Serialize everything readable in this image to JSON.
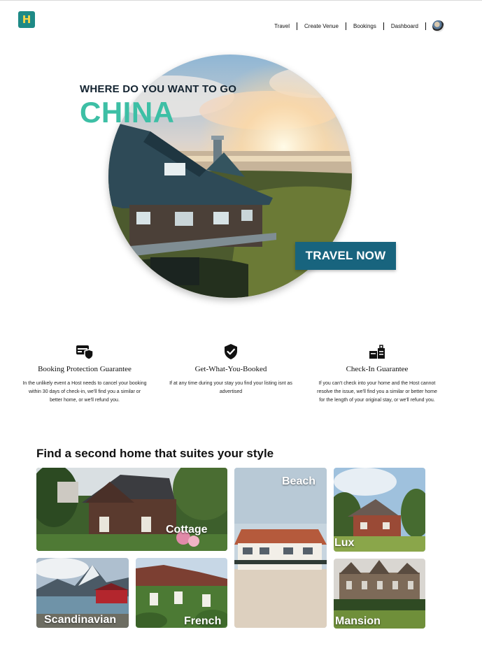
{
  "header": {
    "logo_letter": "H",
    "nav": [
      "Travel",
      "Create Venue",
      "Bookings",
      "Dashboard"
    ]
  },
  "hero": {
    "kicker": "WHERE DO YOU WANT TO GO",
    "destination": "CHINA",
    "cta": "TRAVEL NOW"
  },
  "features": [
    {
      "icon": "booking-protection-icon",
      "title": "Booking Protection Guarantee",
      "text": "In the unlikely event a Host needs to cancel your booking within 30 days of check-in, we'll find you a similar or better home, or we'll refund you."
    },
    {
      "icon": "verified-shield-icon",
      "title": "Get-What-You-Booked",
      "text": "If at any time during your stay you find your listing isnt as advertised"
    },
    {
      "icon": "check-in-icon",
      "title": "Check-In Guarantee",
      "text": "If you can't check into your home and the Host cannot resolve the issue, we'll find you a similar or better home for the length of your original stay, or we'll refund you."
    }
  ],
  "styles_section": {
    "title": "Find a second home that suites your style",
    "tiles": [
      "Cottage",
      "Beach",
      "Lux",
      "Scandinavian",
      "French",
      "Mansion"
    ]
  },
  "colors": {
    "brand_teal": "#3dbfa5",
    "button_blue": "#18647e",
    "logo_bg": "#1e8a86"
  }
}
